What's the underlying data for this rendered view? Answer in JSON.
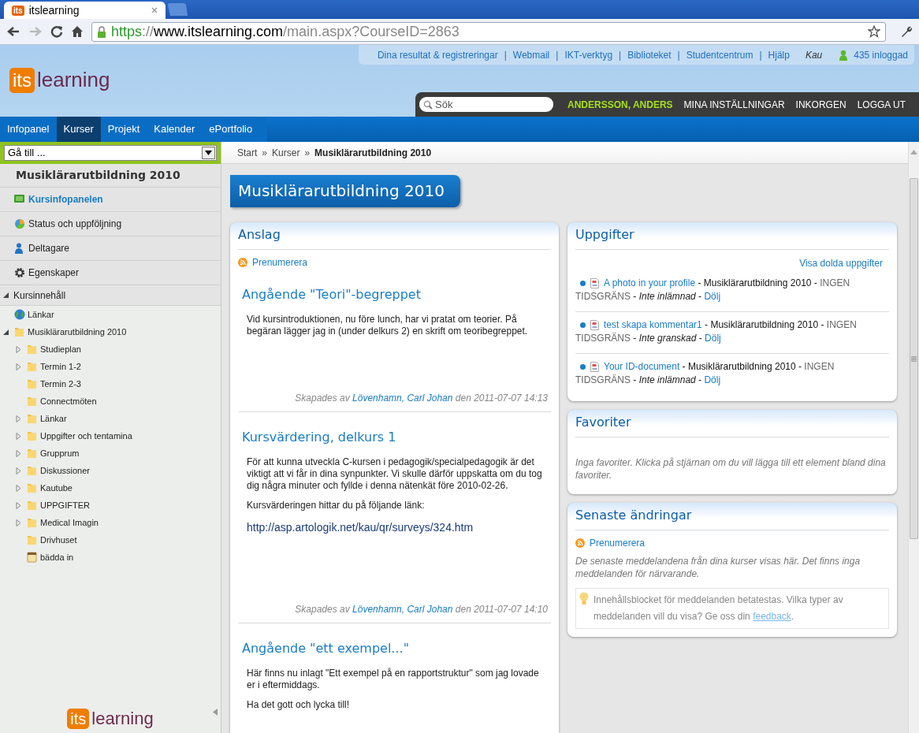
{
  "browser": {
    "tab_title": "itslearning",
    "tab_logo": "its",
    "url": {
      "scheme": "https",
      "separator": "://",
      "host": "www.itslearning.com",
      "path": "/main.aspx?CourseID=2863"
    }
  },
  "header": {
    "logo": {
      "badge": "its",
      "word": "learning"
    },
    "top_links": [
      "Dina resultat & registreringar",
      "Webmail",
      "IKT-verktyg",
      "Biblioteket",
      "Studentcentrum",
      "Hjälp"
    ],
    "link_separator": "|",
    "site": "Kau",
    "online": "435 inloggad"
  },
  "user_bar": {
    "search": {
      "placeholder": "Sök"
    },
    "user": "ANDERSSON, ANDERS",
    "links": [
      "MINA INSTÄLLNINGAR",
      "INKORGEN",
      "LOGGA UT"
    ]
  },
  "nav_tabs": [
    {
      "label": "Infopanel",
      "selected": false
    },
    {
      "label": "Kurser",
      "selected": true
    },
    {
      "label": "Projekt",
      "selected": false
    },
    {
      "label": "Kalender",
      "selected": false
    },
    {
      "label": "ePortfolio",
      "selected": false
    }
  ],
  "sidebar": {
    "goto": {
      "value": "Gå till ..."
    },
    "course_title": "Musiklärarutbildning 2010",
    "menu": [
      {
        "kind": "panel",
        "label": "Kursinfopanelen",
        "selected": true
      },
      {
        "kind": "status",
        "label": "Status och uppföljning",
        "selected": false
      },
      {
        "kind": "people",
        "label": "Deltagare",
        "selected": false
      },
      {
        "kind": "settings",
        "label": "Egenskaper",
        "selected": false
      }
    ],
    "section": {
      "label": "Kursinnehåll",
      "expanded": true
    },
    "tree": [
      {
        "kind": "globe",
        "label": "Länkar"
      },
      {
        "kind": "folder",
        "label": "Musiklärarutbildning 2010",
        "expanded": true,
        "children": [
          {
            "kind": "folder",
            "label": "Studieplan",
            "expanded": false
          },
          {
            "kind": "folder",
            "label": "Termin 1-2",
            "expanded": false
          },
          {
            "kind": "folder",
            "label": "Termin 2-3"
          },
          {
            "kind": "folder",
            "label": "Connectmöten"
          },
          {
            "kind": "folder",
            "label": "Länkar",
            "expanded": false
          },
          {
            "kind": "folder",
            "label": "Uppgifter och tentamina",
            "expanded": false
          },
          {
            "kind": "folder",
            "label": "Grupprum",
            "expanded": false
          },
          {
            "kind": "folder",
            "label": "Diskussioner",
            "expanded": false
          },
          {
            "kind": "folder",
            "label": "Kautube",
            "expanded": false
          },
          {
            "kind": "folder",
            "label": "UPPGIFTER",
            "expanded": false
          },
          {
            "kind": "folder",
            "label": "Medical Imagin",
            "expanded": false
          },
          {
            "kind": "folder",
            "label": "Drivhuset"
          },
          {
            "kind": "note",
            "label": "bädda in"
          }
        ]
      }
    ],
    "footer_logo": {
      "badge": "its",
      "word": "learning"
    }
  },
  "breadcrumb": {
    "separator": "»",
    "items": [
      {
        "label": "Start",
        "current": false
      },
      {
        "label": "Kurser",
        "current": false
      },
      {
        "label": "Musiklärarutbildning 2010",
        "current": true
      }
    ]
  },
  "page_title": "Musiklärarutbildning 2010",
  "announcements": {
    "title": "Anslag",
    "subscribe": "Prenumerera",
    "items": [
      {
        "title": "Angående \"Teori\"-begreppet",
        "paragraphs": [
          "Vid kursintroduktionen, nu före lunch, har vi pratat om teorier. På begäran lägger jag in (under delkurs 2) en skrift om teoribegreppet."
        ],
        "footer": {
          "prefix": "Skapades av",
          "author": "Lövenhamn, Carl Johan",
          "suffix": "den 2011-07-07 14:13"
        }
      },
      {
        "title": "Kursvärdering, delkurs 1",
        "paragraphs": [
          "För att kunna utveckla C-kursen i pedagogik/specialpedagogik är det viktigt att vi får in dina synpunkter. Vi skulle därför uppskatta om du tog dig några minuter och fyllde i denna nätenkät före 2010-02-26.",
          "Kursvärderingen hittar du på följande länk:"
        ],
        "link": "http://asp.artologik.net/kau/qr/surveys/324.htm",
        "footer": {
          "prefix": "Skapades av",
          "author": "Lövenhamn, Carl Johan",
          "suffix": "den 2011-07-07 14:10"
        }
      },
      {
        "title": "Angående \"ett exempel...\"",
        "paragraphs": [
          "Här finns nu inlagt \"Ett exempel på en rapportstruktur\" som jag lovade er i eftermiddags.",
          "Ha det gott och lycka till!"
        ]
      }
    ]
  },
  "tasks": {
    "title": "Uppgifter",
    "show_hidden": "Visa dolda uppgifter",
    "items": [
      {
        "segments": [
          {
            "kind": "link",
            "text": "A photo in your profile"
          },
          {
            "kind": "plain",
            "text": " - Musiklärarutbildning 2010 - "
          },
          {
            "kind": "muted",
            "text": "INGEN TIDSGRÄNS"
          },
          {
            "kind": "plain",
            "text": " - "
          },
          {
            "kind": "status",
            "text": "Inte inlämnad"
          },
          {
            "kind": "plain",
            "text": " - "
          },
          {
            "kind": "link",
            "text": "Dölj"
          }
        ]
      },
      {
        "segments": [
          {
            "kind": "link",
            "text": "test skapa kommentar1"
          },
          {
            "kind": "plain",
            "text": " - Musiklärarutbildning 2010 - "
          },
          {
            "kind": "muted",
            "text": "INGEN TIDSGRÄNS"
          },
          {
            "kind": "plain",
            "text": " - "
          },
          {
            "kind": "status",
            "text": "Inte granskad"
          },
          {
            "kind": "plain",
            "text": " - "
          },
          {
            "kind": "link",
            "text": "Dölj"
          }
        ]
      },
      {
        "segments": [
          {
            "kind": "link",
            "text": "Your ID-document"
          },
          {
            "kind": "plain",
            "text": " - Musiklärarutbildning 2010 - "
          },
          {
            "kind": "muted",
            "text": "INGEN TIDSGRÄNS"
          },
          {
            "kind": "plain",
            "text": " - "
          },
          {
            "kind": "status",
            "text": "Inte inlämnad"
          },
          {
            "kind": "plain",
            "text": " - "
          },
          {
            "kind": "link",
            "text": "Dölj"
          }
        ]
      }
    ]
  },
  "favorites": {
    "title": "Favoriter",
    "empty": "Inga favoriter. Klicka på stjärnan om du vill lägga till ett element bland dina favoriter."
  },
  "recent_changes": {
    "title": "Senaste ändringar",
    "subscribe": "Prenumerera",
    "empty": "De senaste meddelandena från dina kurser visas här. Det finns inga meddelanden för närvarande.",
    "notice": {
      "text": "Innehållsblocket för meddelanden betatestas. Vilka typer av meddelanden vill du visa? Ge oss din",
      "link": "feedback",
      "after": "."
    }
  }
}
